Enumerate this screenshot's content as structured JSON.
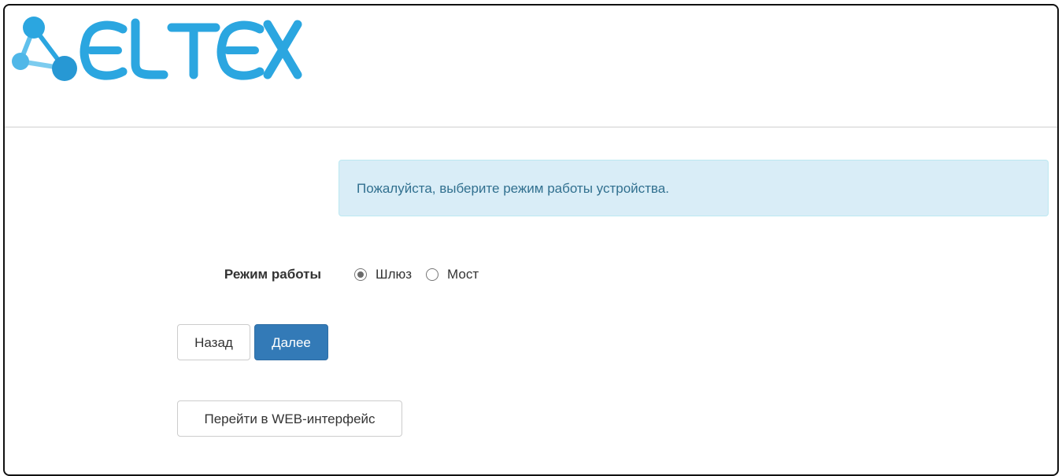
{
  "header": {
    "logo_text": "ELTEX"
  },
  "alert": {
    "message": "Пожалуйста, выберите режим работы устройства."
  },
  "mode": {
    "label": "Режим работы",
    "options": [
      {
        "label": "Шлюз",
        "checked": true
      },
      {
        "label": "Мост",
        "checked": false
      }
    ]
  },
  "buttons": {
    "back": "Назад",
    "next": "Далее",
    "web_interface": "Перейти в WEB-интерфейс"
  },
  "colors": {
    "logo_blue": "#2ba6e0",
    "alert_bg": "#d9edf7",
    "alert_text": "#31708f",
    "primary": "#337ab7"
  }
}
